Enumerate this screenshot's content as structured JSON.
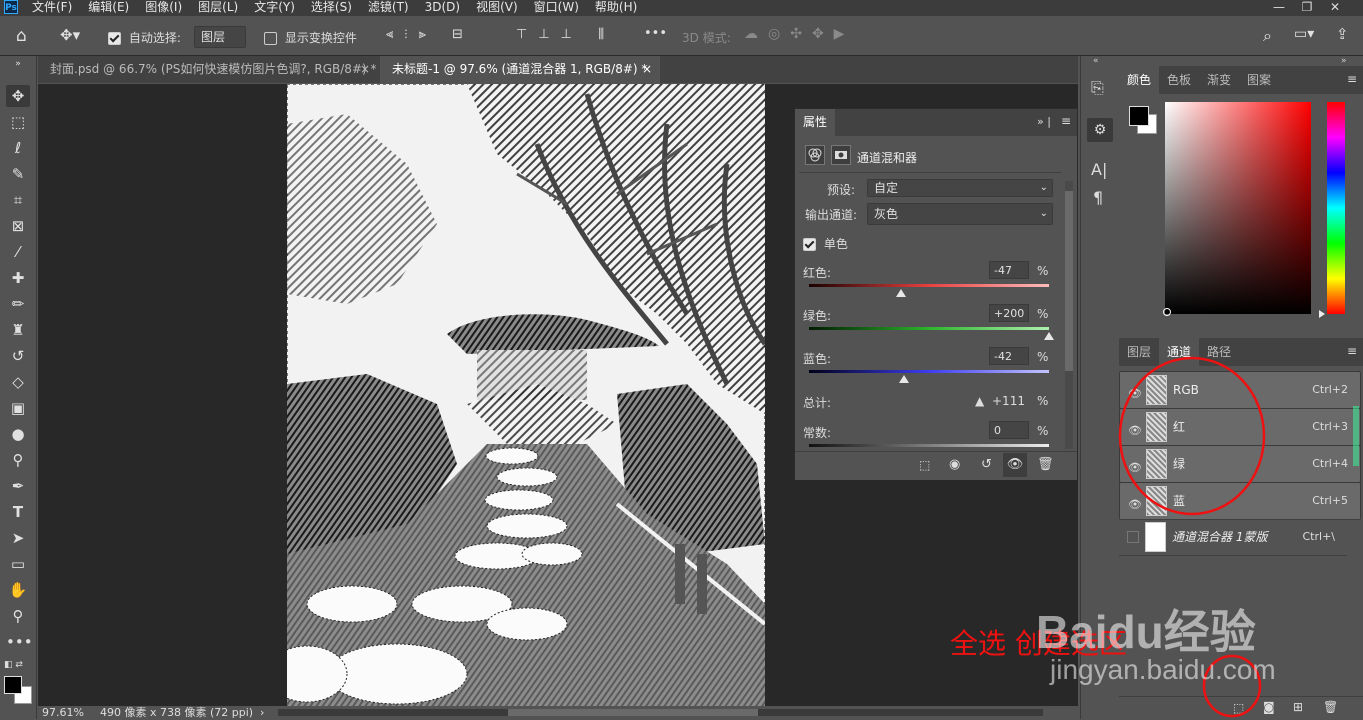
{
  "menubar": {
    "logo": "Ps",
    "items": [
      "文件(F)",
      "编辑(E)",
      "图像(I)",
      "图层(L)",
      "文字(Y)",
      "选择(S)",
      "滤镜(T)",
      "3D(D)",
      "视图(V)",
      "窗口(W)",
      "帮助(H)"
    ],
    "window_controls": [
      "—",
      "❐",
      "✕"
    ]
  },
  "options_bar": {
    "auto_select_label": "自动选择:",
    "auto_select_value": "图层",
    "show_transform_label": "显示变换控件",
    "mode_3d_label": "3D 模式:",
    "more": "•••"
  },
  "tabs": [
    {
      "label": "封面.psd @ 66.7% (PS如何快速模仿图片色调?, RGB/8#) *",
      "close": "×"
    },
    {
      "label": "未标题-1 @ 97.6% (通道混合器 1, RGB/8#) *",
      "close": "×"
    }
  ],
  "status": {
    "zoom": "97.61%",
    "doc_info": "490 像素 x 738 像素 (72 ppi)",
    "arrow": "›"
  },
  "properties": {
    "tab": "属性",
    "title": "通道混和器",
    "preset_label": "预设:",
    "preset_value": "自定",
    "output_label": "输出通道:",
    "output_value": "灰色",
    "mono_label": "单色",
    "red_label": "红色:",
    "red_value": "-47",
    "green_label": "绿色:",
    "green_value": "+200",
    "blue_label": "蓝色:",
    "blue_value": "-42",
    "total_label": "总计:",
    "total_value": "+111",
    "const_label": "常数:",
    "const_value": "0",
    "percent": "%",
    "slider_levels": {
      "red": -47,
      "green": 200,
      "blue": -42,
      "constant": 0
    }
  },
  "color_panel": {
    "tabs": [
      "颜色",
      "色板",
      "渐变",
      "图案"
    ],
    "foreground": "#000000",
    "background": "#ffffff",
    "hue": "#ff0000"
  },
  "channels_panel": {
    "tabs": [
      "图层",
      "通道",
      "路径"
    ],
    "rows": [
      {
        "name": "RGB",
        "shortcut": "Ctrl+2"
      },
      {
        "name": "红",
        "shortcut": "Ctrl+3"
      },
      {
        "name": "绿",
        "shortcut": "Ctrl+4"
      },
      {
        "name": "蓝",
        "shortcut": "Ctrl+5"
      },
      {
        "name": "通道混合器 1蒙版",
        "shortcut": "Ctrl+\\"
      }
    ]
  },
  "overlay": {
    "annotation": "全选 创建选区",
    "watermark_brand": "Baidu经验",
    "watermark_url": "jingyan.baidu.com"
  }
}
